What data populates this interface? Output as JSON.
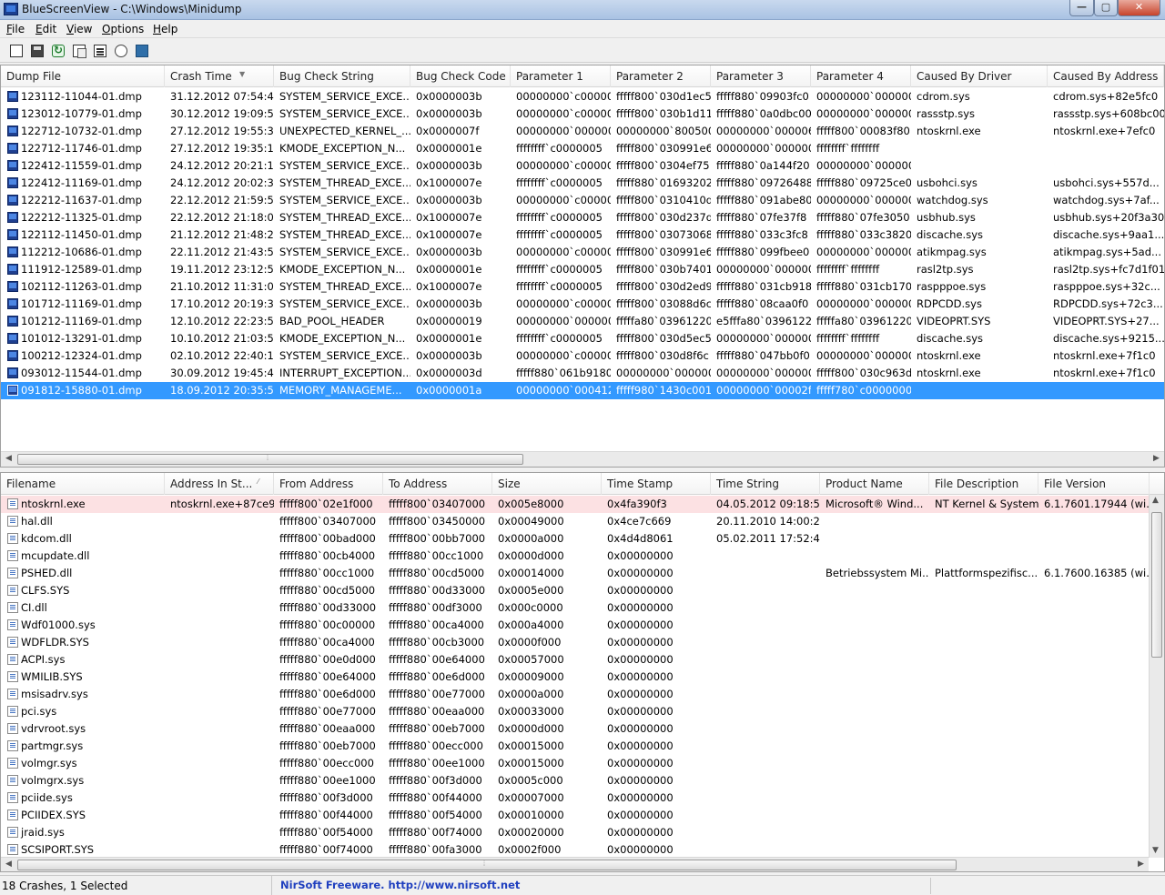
{
  "window": {
    "title": "BlueScreenView  -  C:\\Windows\\Minidump",
    "min_glyph": "—",
    "max_glyph": "▢",
    "close_glyph": "✕"
  },
  "menu": [
    "File",
    "Edit",
    "View",
    "Options",
    "Help"
  ],
  "toolbar_icons": [
    "html-report-icon",
    "save-icon",
    "refresh-icon",
    "copy-icon",
    "properties-icon",
    "find-icon",
    "exit-icon"
  ],
  "crash_list": {
    "columns": [
      "Dump File",
      "Crash Time",
      "Bug Check String",
      "Bug Check Code",
      "Parameter 1",
      "Parameter 2",
      "Parameter 3",
      "Parameter 4",
      "Caused By Driver",
      "Caused By Address"
    ],
    "rows": [
      [
        "123112-11044-01.dmp",
        "31.12.2012 07:54:46",
        "SYSTEM_SERVICE_EXCE...",
        "0x0000003b",
        "00000000`c00000...",
        "fffff800`030d1ec5",
        "fffff880`09903fc0",
        "00000000`000000...",
        "cdrom.sys",
        "cdrom.sys+82e5fc0"
      ],
      [
        "123012-10779-01.dmp",
        "30.12.2012 19:09:55",
        "SYSTEM_SERVICE_EXCE...",
        "0x0000003b",
        "00000000`c00000...",
        "fffff800`030b1d11",
        "fffff880`0a0dbc00",
        "00000000`000000...",
        "rassstp.sys",
        "rassstp.sys+608bc00"
      ],
      [
        "122712-10732-01.dmp",
        "27.12.2012 19:55:38",
        "UNEXPECTED_KERNEL_...",
        "0x0000007f",
        "00000000`000000...",
        "00000000`800500...",
        "00000000`000006f8",
        "fffff800`00083f80",
        "ntoskrnl.exe",
        "ntoskrnl.exe+7efc0"
      ],
      [
        "122712-11746-01.dmp",
        "27.12.2012 19:35:10",
        "KMODE_EXCEPTION_N...",
        "0x0000001e",
        "ffffffff`c0000005",
        "fffff800`030991e6",
        "00000000`000000...",
        "ffffffff`ffffffff",
        "",
        ""
      ],
      [
        "122412-11559-01.dmp",
        "24.12.2012 20:21:19",
        "SYSTEM_SERVICE_EXCE...",
        "0x0000003b",
        "00000000`c00000...",
        "fffff800`0304ef75",
        "fffff880`0a144f20",
        "00000000`000000...",
        "",
        ""
      ],
      [
        "122412-11169-01.dmp",
        "24.12.2012 20:02:31",
        "SYSTEM_THREAD_EXCE...",
        "0x1000007e",
        "ffffffff`c0000005",
        "fffff880`01693202",
        "fffff880`09726488",
        "fffff880`09725ce0",
        "usbohci.sys",
        "usbohci.sys+557d..."
      ],
      [
        "122212-11637-01.dmp",
        "22.12.2012 21:59:53",
        "SYSTEM_SERVICE_EXCE...",
        "0x0000003b",
        "00000000`c00000...",
        "fffff800`0310410d",
        "fffff880`091abe80",
        "00000000`000000...",
        "watchdog.sys",
        "watchdog.sys+7af..."
      ],
      [
        "122212-11325-01.dmp",
        "22.12.2012 21:18:09",
        "SYSTEM_THREAD_EXCE...",
        "0x1000007e",
        "ffffffff`c0000005",
        "fffff800`030d237d",
        "fffff880`07fe37f8",
        "fffff880`07fe3050",
        "usbhub.sys",
        "usbhub.sys+20f3a30"
      ],
      [
        "122112-11450-01.dmp",
        "21.12.2012 21:48:27",
        "SYSTEM_THREAD_EXCE...",
        "0x1000007e",
        "ffffffff`c0000005",
        "fffff800`03073068",
        "fffff880`033c3fc8",
        "fffff880`033c3820",
        "discache.sys",
        "discache.sys+9aa1..."
      ],
      [
        "112212-10686-01.dmp",
        "22.11.2012 21:43:57",
        "SYSTEM_SERVICE_EXCE...",
        "0x0000003b",
        "00000000`c00000...",
        "fffff800`030991e6",
        "fffff880`099fbee0",
        "00000000`000000...",
        "atikmpag.sys",
        "atikmpag.sys+5ad..."
      ],
      [
        "111912-12589-01.dmp",
        "19.11.2012 23:12:57",
        "KMODE_EXCEPTION_N...",
        "0x0000001e",
        "ffffffff`c0000005",
        "fffff800`030b7401",
        "00000000`000000...",
        "ffffffff`ffffffff",
        "rasl2tp.sys",
        "rasl2tp.sys+fc7d1f01"
      ],
      [
        "102112-11263-01.dmp",
        "21.10.2012 11:31:07",
        "SYSTEM_THREAD_EXCE...",
        "0x1000007e",
        "ffffffff`c0000005",
        "fffff800`030d2ed9",
        "fffff880`031cb918",
        "fffff880`031cb170",
        "raspppoe.sys",
        "raspppoe.sys+32c..."
      ],
      [
        "101712-11169-01.dmp",
        "17.10.2012 20:19:33",
        "SYSTEM_SERVICE_EXCE...",
        "0x0000003b",
        "00000000`c00000...",
        "fffff800`03088d6c",
        "fffff880`08caa0f0",
        "00000000`000000...",
        "RDPCDD.sys",
        "RDPCDD.sys+72c3..."
      ],
      [
        "101212-11169-01.dmp",
        "12.10.2012 22:23:53",
        "BAD_POOL_HEADER",
        "0x00000019",
        "00000000`000000...",
        "fffffa80`03961220",
        "e5fffa80`03961220",
        "fffffa80`03961220",
        "VIDEOPRT.SYS",
        "VIDEOPRT.SYS+27..."
      ],
      [
        "101012-13291-01.dmp",
        "10.10.2012 21:03:58",
        "KMODE_EXCEPTION_N...",
        "0x0000001e",
        "ffffffff`c0000005",
        "fffff800`030d5ec5",
        "00000000`000000...",
        "ffffffff`ffffffff",
        "discache.sys",
        "discache.sys+9215..."
      ],
      [
        "100212-12324-01.dmp",
        "02.10.2012 22:40:18",
        "SYSTEM_SERVICE_EXCE...",
        "0x0000003b",
        "00000000`c00000...",
        "fffff800`030d8f6c",
        "fffff880`047bb0f0",
        "00000000`000000...",
        "ntoskrnl.exe",
        "ntoskrnl.exe+7f1c0"
      ],
      [
        "093012-11544-01.dmp",
        "30.09.2012 19:45:41",
        "INTERRUPT_EXCEPTION...",
        "0x0000003d",
        "fffff880`061b9180",
        "00000000`000000...",
        "00000000`000000...",
        "fffff800`030c963d",
        "ntoskrnl.exe",
        "ntoskrnl.exe+7f1c0"
      ],
      [
        "091812-15880-01.dmp",
        "18.09.2012 20:35:55",
        "MEMORY_MANAGEME...",
        "0x0000001a",
        "00000000`000412...",
        "fffff980`1430c001",
        "00000000`00002fd2",
        "fffff780`c0000000",
        "",
        ""
      ]
    ],
    "selected_index": 17
  },
  "module_list": {
    "columns": [
      "Filename",
      "Address In St...",
      "From Address",
      "To Address",
      "Size",
      "Time Stamp",
      "Time String",
      "Product Name",
      "File Description",
      "File Version"
    ],
    "rows": [
      [
        "ntoskrnl.exe",
        "ntoskrnl.exe+87ce9",
        "fffff800`02e1f000",
        "fffff800`03407000",
        "0x005e8000",
        "0x4fa390f3",
        "04.05.2012 09:18:59",
        "Microsoft® Wind...",
        "NT Kernel & System",
        "6.1.7601.17944 (wi..."
      ],
      [
        "hal.dll",
        "",
        "fffff800`03407000",
        "fffff800`03450000",
        "0x00049000",
        "0x4ce7c669",
        "20.11.2010 14:00:25",
        "",
        "",
        ""
      ],
      [
        "kdcom.dll",
        "",
        "fffff800`00bad000",
        "fffff800`00bb7000",
        "0x0000a000",
        "0x4d4d8061",
        "05.02.2011 17:52:49",
        "",
        "",
        ""
      ],
      [
        "mcupdate.dll",
        "",
        "fffff880`00cb4000",
        "fffff880`00cc1000",
        "0x0000d000",
        "0x00000000",
        "",
        "",
        "",
        ""
      ],
      [
        "PSHED.dll",
        "",
        "fffff880`00cc1000",
        "fffff880`00cd5000",
        "0x00014000",
        "0x00000000",
        "",
        "Betriebssystem Mi...",
        "Plattformspezifisc...",
        "6.1.7600.16385 (wi..."
      ],
      [
        "CLFS.SYS",
        "",
        "fffff880`00cd5000",
        "fffff880`00d33000",
        "0x0005e000",
        "0x00000000",
        "",
        "",
        "",
        ""
      ],
      [
        "CI.dll",
        "",
        "fffff880`00d33000",
        "fffff880`00df3000",
        "0x000c0000",
        "0x00000000",
        "",
        "",
        "",
        ""
      ],
      [
        "Wdf01000.sys",
        "",
        "fffff880`00c00000",
        "fffff880`00ca4000",
        "0x000a4000",
        "0x00000000",
        "",
        "",
        "",
        ""
      ],
      [
        "WDFLDR.SYS",
        "",
        "fffff880`00ca4000",
        "fffff880`00cb3000",
        "0x0000f000",
        "0x00000000",
        "",
        "",
        "",
        ""
      ],
      [
        "ACPI.sys",
        "",
        "fffff880`00e0d000",
        "fffff880`00e64000",
        "0x00057000",
        "0x00000000",
        "",
        "",
        "",
        ""
      ],
      [
        "WMILIB.SYS",
        "",
        "fffff880`00e64000",
        "fffff880`00e6d000",
        "0x00009000",
        "0x00000000",
        "",
        "",
        "",
        ""
      ],
      [
        "msisadrv.sys",
        "",
        "fffff880`00e6d000",
        "fffff880`00e77000",
        "0x0000a000",
        "0x00000000",
        "",
        "",
        "",
        ""
      ],
      [
        "pci.sys",
        "",
        "fffff880`00e77000",
        "fffff880`00eaa000",
        "0x00033000",
        "0x00000000",
        "",
        "",
        "",
        ""
      ],
      [
        "vdrvroot.sys",
        "",
        "fffff880`00eaa000",
        "fffff880`00eb7000",
        "0x0000d000",
        "0x00000000",
        "",
        "",
        "",
        ""
      ],
      [
        "partmgr.sys",
        "",
        "fffff880`00eb7000",
        "fffff880`00ecc000",
        "0x00015000",
        "0x00000000",
        "",
        "",
        "",
        ""
      ],
      [
        "volmgr.sys",
        "",
        "fffff880`00ecc000",
        "fffff880`00ee1000",
        "0x00015000",
        "0x00000000",
        "",
        "",
        "",
        ""
      ],
      [
        "volmgrx.sys",
        "",
        "fffff880`00ee1000",
        "fffff880`00f3d000",
        "0x0005c000",
        "0x00000000",
        "",
        "",
        "",
        ""
      ],
      [
        "pciide.sys",
        "",
        "fffff880`00f3d000",
        "fffff880`00f44000",
        "0x00007000",
        "0x00000000",
        "",
        "",
        "",
        ""
      ],
      [
        "PCIIDEX.SYS",
        "",
        "fffff880`00f44000",
        "fffff880`00f54000",
        "0x00010000",
        "0x00000000",
        "",
        "",
        "",
        ""
      ],
      [
        "jraid.sys",
        "",
        "fffff880`00f54000",
        "fffff880`00f74000",
        "0x00020000",
        "0x00000000",
        "",
        "",
        "",
        ""
      ],
      [
        "SCSIPORT.SYS",
        "",
        "fffff880`00f74000",
        "fffff880`00fa3000",
        "0x0002f000",
        "0x00000000",
        "",
        "",
        "",
        ""
      ]
    ],
    "highlighted_index": 0
  },
  "status": {
    "summary": "18 Crashes, 1 Selected",
    "link": "NirSoft Freeware.  http://www.nirsoft.net"
  },
  "colors": {
    "selection": "#3399ff",
    "highlight": "#fce1e3",
    "link": "#1f3fbf"
  }
}
